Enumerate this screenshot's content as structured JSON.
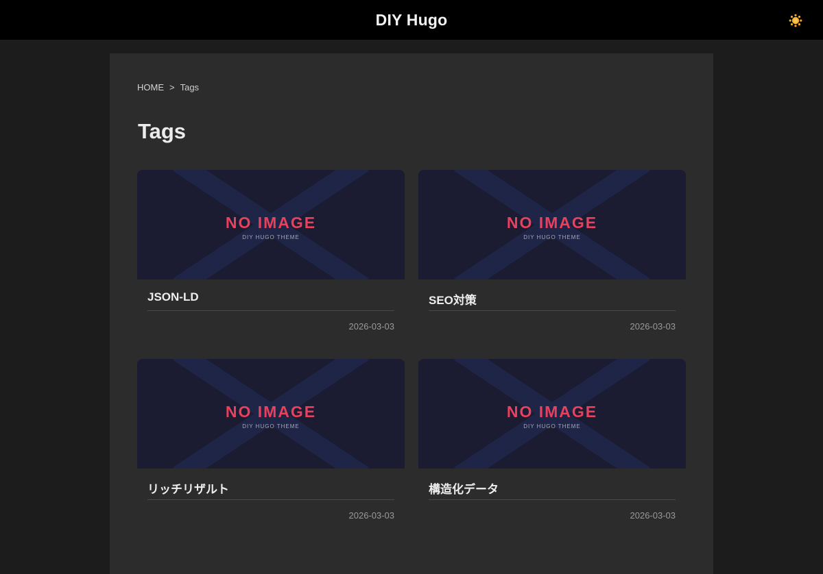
{
  "header": {
    "site_title": "DIY Hugo",
    "theme_toggle_icon": "sun-icon",
    "accent_color": "#f5a623"
  },
  "breadcrumb": {
    "home": "HOME",
    "separator": ">",
    "current": "Tags"
  },
  "page": {
    "title": "Tags"
  },
  "placeholder": {
    "main": "NO IMAGE",
    "sub": "DIY HUGO THEME",
    "main_color": "#e8415e"
  },
  "cards": [
    {
      "title": "JSON-LD",
      "date": "2026-03-03"
    },
    {
      "title": "SEO対策",
      "date": "2026-03-03"
    },
    {
      "title": "リッチリザルト",
      "date": "2026-03-03"
    },
    {
      "title": "構造化データ",
      "date": "2026-03-03"
    }
  ]
}
